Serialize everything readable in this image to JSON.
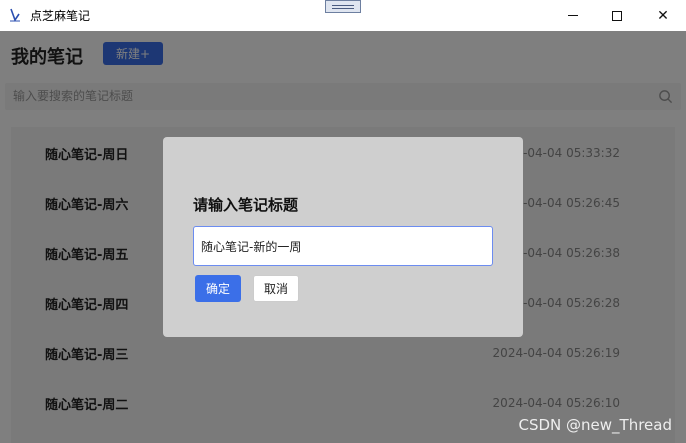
{
  "window": {
    "title": "点芝麻笔记",
    "icons": [
      "app-logo-icon",
      "minimize-icon",
      "maximize-icon",
      "close-icon"
    ],
    "close_glyph": "✕"
  },
  "header": {
    "title": "我的笔记",
    "new_button": "新建+"
  },
  "search": {
    "placeholder": "输入要搜索的笔记标题"
  },
  "notes": [
    {
      "title": "随心笔记-周日",
      "time": "2024-04-04 05:33:32"
    },
    {
      "title": "随心笔记-周六",
      "time": "2024-04-04 05:26:45"
    },
    {
      "title": "随心笔记-周五",
      "time": "2024-04-04 05:26:38"
    },
    {
      "title": "随心笔记-周四",
      "time": "2024-04-04 05:26:28"
    },
    {
      "title": "随心笔记-周三",
      "time": "2024-04-04 05:26:19"
    },
    {
      "title": "随心笔记-周二",
      "time": "2024-04-04 05:26:10"
    }
  ],
  "dialog": {
    "title": "请输入笔记标题",
    "input_value": "随心笔记-新的一周",
    "ok_button": "确定",
    "cancel_button": "取消"
  },
  "watermark": "CSDN @new_Thread",
  "colors": {
    "accent": "#3b6fe8",
    "dialog_bg": "#cfcfcf",
    "overlay": "rgba(0,0,0,0.5)"
  }
}
